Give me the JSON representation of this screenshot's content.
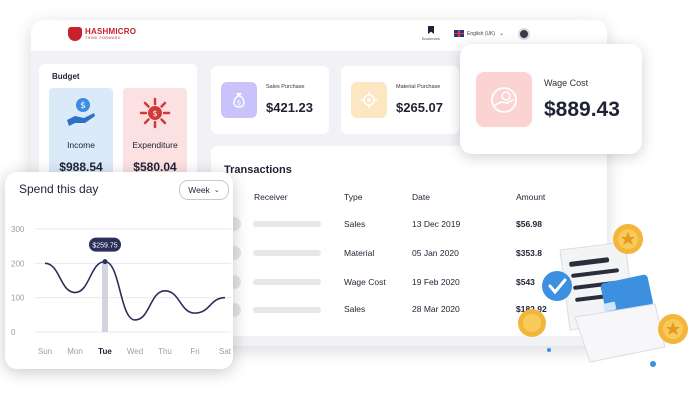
{
  "brand": {
    "name": "HASHMICRO",
    "tagline": "THINK FORWARD"
  },
  "topbar": {
    "bookmark_label": "Bookmark",
    "language": "English (UK)"
  },
  "budget": {
    "title": "Budget",
    "income": {
      "label": "Income",
      "value": "$988.54",
      "icon": "hand-coin-icon"
    },
    "expenditure": {
      "label": "Expenditure",
      "value": "$580.04",
      "icon": "spending-icon"
    }
  },
  "purchases": [
    {
      "label": "Sales Purchase",
      "value": "$421.23",
      "icon": "money-bag-icon"
    },
    {
      "label": "Material Purchase",
      "value": "$265.07",
      "icon": "gear-icon"
    }
  ],
  "wage": {
    "label": "Wage Cost",
    "value": "$889.43",
    "icon": "coins-hand-icon"
  },
  "transactions": {
    "title": "Transactions",
    "columns": [
      "Receiver",
      "Type",
      "Date",
      "Amount"
    ],
    "rows": [
      {
        "type": "Sales",
        "date": "13 Dec 2019",
        "amount": "$56.98"
      },
      {
        "type": "Material",
        "date": "05 Jan 2020",
        "amount": "$353.8"
      },
      {
        "type": "Wage Cost",
        "date": "19 Feb 2020",
        "amount": "$543"
      },
      {
        "type": "Sales",
        "date": "28 Mar 2020",
        "amount": "$182.92"
      }
    ]
  },
  "spend": {
    "title": "Spend this day",
    "period": "Week",
    "tooltip": "$259.75",
    "selected_day": "Tue"
  },
  "colors": {
    "brand": "#c8212c",
    "income_bg": "#dbeaf8",
    "expense_bg": "#fbe1e1",
    "line": "#2b2f5a",
    "tooltip_bg": "#2b2f5a"
  },
  "chart_data": {
    "type": "line",
    "title": "Spend this day",
    "x": [
      "Sun",
      "Mon",
      "Tue",
      "Wed",
      "Thu",
      "Fri",
      "Sat"
    ],
    "yticks": [
      0,
      100,
      200,
      300
    ],
    "ylim": [
      0,
      300
    ],
    "series": [
      {
        "values": [
          200,
          115,
          205,
          35,
          120,
          55,
          100
        ]
      }
    ],
    "annotation": {
      "x": "Tue",
      "label": "$259.75"
    },
    "grid": true
  }
}
